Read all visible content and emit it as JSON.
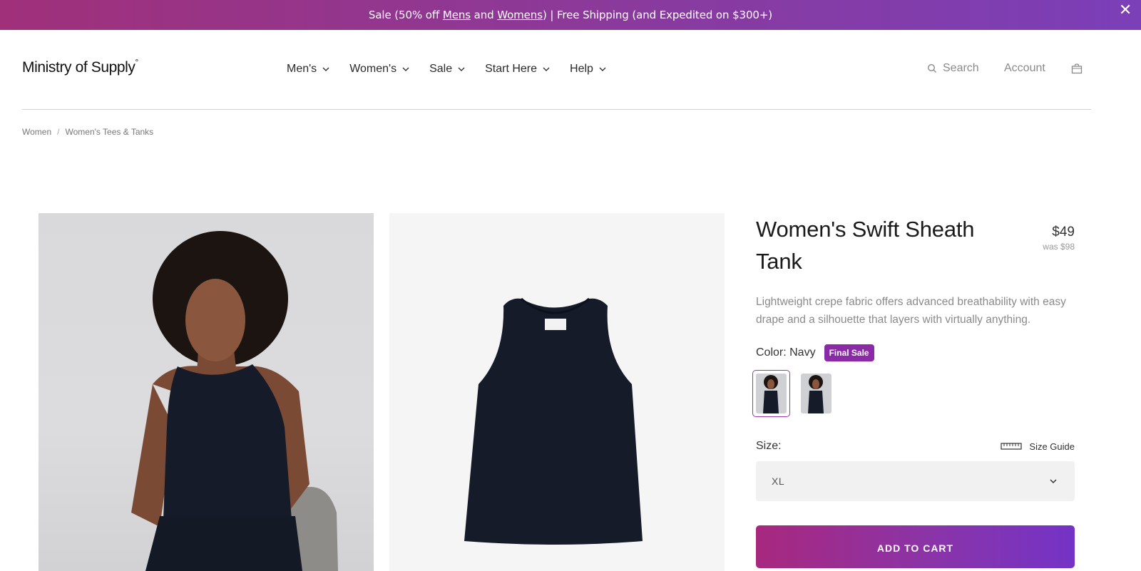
{
  "announcement": {
    "prefix": "Sale (50% off ",
    "mens_link": "Mens",
    "and": " and ",
    "womens_link": "Womens",
    "suffix": ") | Free Shipping (and Expedited on $300+)",
    "close_glyph": "✕"
  },
  "header": {
    "logo": "Ministry of Supply",
    "logo_mark": "°",
    "nav": [
      {
        "label": "Men's"
      },
      {
        "label": "Women's"
      },
      {
        "label": "Sale"
      },
      {
        "label": "Start Here"
      },
      {
        "label": "Help"
      }
    ],
    "search_label": "Search",
    "account_label": "Account"
  },
  "breadcrumb": {
    "items": [
      "Women",
      "Women's Tees & Tanks"
    ],
    "separator": "/"
  },
  "product": {
    "title": "Women's Swift Sheath Tank",
    "price": "$49",
    "was_price": "was $98",
    "description": "Lightweight crepe fabric offers advanced breathability with easy drape and a silhouette that layers with virtually anything.",
    "color_label": "Color: Navy",
    "badge": "Final Sale",
    "size_label": "Size:",
    "size_guide_label": "Size Guide",
    "selected_size": "XL",
    "add_to_cart": "ADD TO CART"
  },
  "colors": {
    "accent": "#8a2aa6",
    "banner_gradient_start": "#a0307a",
    "banner_gradient_end": "#7b3fb8",
    "garment_navy": "#161b29"
  }
}
